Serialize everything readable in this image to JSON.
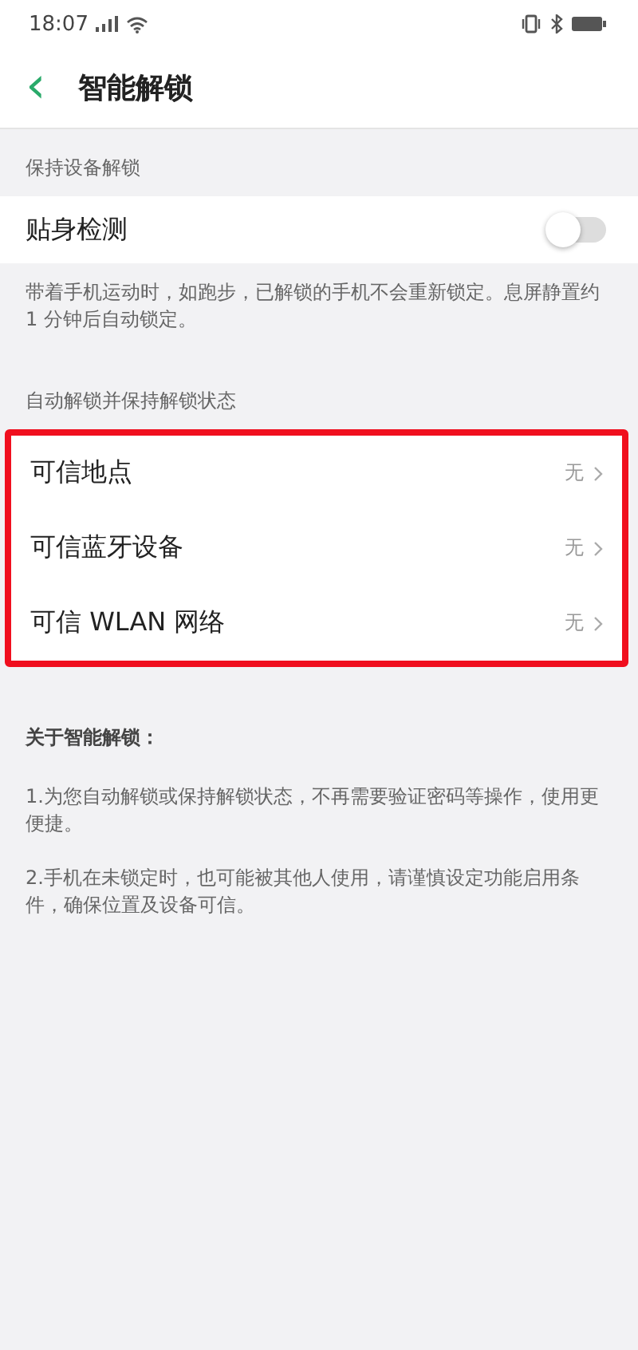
{
  "status_bar": {
    "time": "18:07"
  },
  "header": {
    "back": "‹",
    "title": "智能解锁"
  },
  "sections": [
    {
      "label": "保持设备解锁",
      "kind": "toggle",
      "item": {
        "label": "贴身检测",
        "on": false
      },
      "description": "带着手机运动时，如跑步，已解锁的手机不会重新锁定。息屏静置约 1 分钟后自动锁定。"
    },
    {
      "label": "自动解锁并保持解锁状态",
      "kind": "list",
      "highlighted": true,
      "items": [
        {
          "label": "可信地点",
          "value": "无"
        },
        {
          "label": "可信蓝牙设备",
          "value": "无"
        },
        {
          "label": "可信 WLAN 网络",
          "value": "无"
        }
      ]
    }
  ],
  "about": {
    "title": "关于智能解锁：",
    "notes": [
      "1.为您自动解锁或保持解锁状态，不再需要验证密码等操作，使用更便捷。",
      "2.手机在未锁定时，也可能被其他人使用，请谨慎设定功能启用条件，确保位置及设备可信。"
    ]
  }
}
